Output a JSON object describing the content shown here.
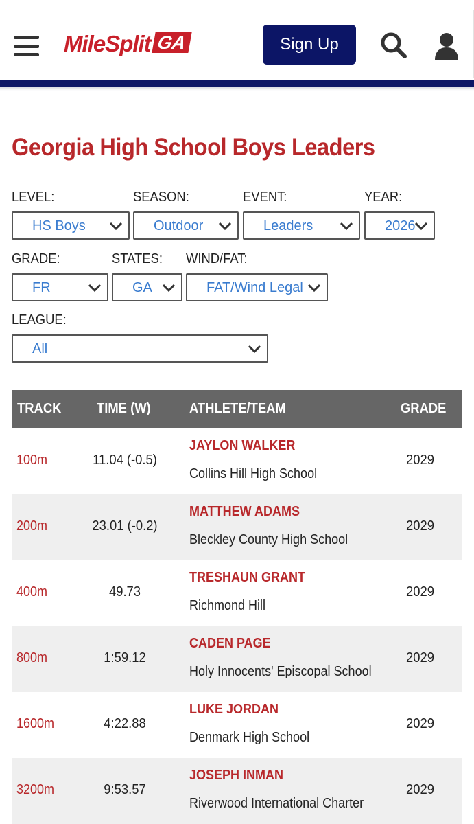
{
  "header": {
    "logo_text": "MileSplit",
    "logo_badge": "GA",
    "signup_label": "Sign Up"
  },
  "page_title": "Georgia High School Boys Leaders",
  "filters": {
    "level": {
      "label": "LEVEL:",
      "value": "HS Boys"
    },
    "season": {
      "label": "SEASON:",
      "value": "Outdoor"
    },
    "event": {
      "label": "EVENT:",
      "value": "Leaders"
    },
    "year": {
      "label": "YEAR:",
      "value": "2026"
    },
    "grade": {
      "label": "GRADE:",
      "value": "FR"
    },
    "states": {
      "label": "STATES:",
      "value": "GA"
    },
    "wind": {
      "label": "WIND/FAT:",
      "value": "FAT/Wind Legal"
    },
    "league": {
      "label": "LEAGUE:",
      "value": "All"
    }
  },
  "table": {
    "headers": {
      "track": "TRACK",
      "time": "TIME (W)",
      "athlete": "ATHLETE/TEAM",
      "grade": "GRADE"
    },
    "rows": [
      {
        "event": "100m",
        "time": "11.04 (-0.5)",
        "athlete": "JAYLON WALKER",
        "team": "Collins Hill High School",
        "grade": "2029"
      },
      {
        "event": "200m",
        "time": "23.01 (-0.2)",
        "athlete": "MATTHEW ADAMS",
        "team": "Bleckley County High School",
        "grade": "2029"
      },
      {
        "event": "400m",
        "time": "49.73",
        "athlete": "TRESHAUN GRANT",
        "team": "Richmond Hill",
        "grade": "2029"
      },
      {
        "event": "800m",
        "time": "1:59.12",
        "athlete": "CADEN PAGE",
        "team": "Holy Innocents' Episcopal School",
        "grade": "2029"
      },
      {
        "event": "1600m",
        "time": "4:22.88",
        "athlete": "LUKE JORDAN",
        "team": "Denmark High School",
        "grade": "2029"
      },
      {
        "event": "3200m",
        "time": "9:53.57",
        "athlete": "JOSEPH INMAN",
        "team": "Riverwood International Charter",
        "grade": "2029"
      }
    ]
  },
  "colors": {
    "brand_red": "#b8282b",
    "navy": "#0c1566",
    "link_blue": "#3a7ccf",
    "header_gray": "#666666"
  }
}
